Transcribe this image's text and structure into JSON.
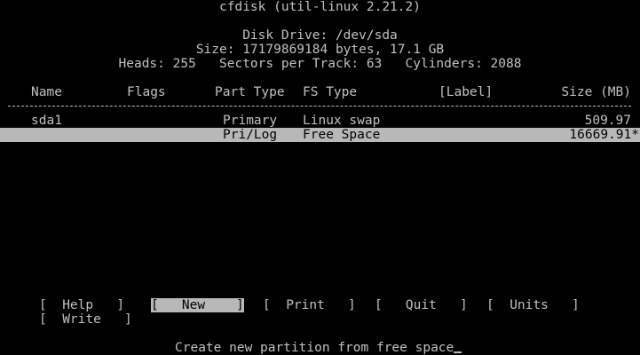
{
  "header": {
    "program": "cfdisk (util-linux 2.21.2)",
    "drive": "Disk Drive: /dev/sda",
    "size": "Size: 17179869184 bytes, 17.1 GB",
    "geometry": "Heads: 255   Sectors per Track: 63   Cylinders: 2088"
  },
  "columns": {
    "name": "Name",
    "flags": "Flags",
    "part_type": "Part Type",
    "fs_type": "FS Type",
    "label": "[Label]",
    "size": "Size (MB)"
  },
  "partitions": [
    {
      "name": "sda1",
      "flags": "",
      "part_type": "Primary",
      "fs_type": "Linux swap",
      "label": "",
      "size": "509.97"
    },
    {
      "name": "",
      "flags": "",
      "part_type": "Pri/Log",
      "fs_type": "Free Space",
      "label": "",
      "size": "16669.91*"
    }
  ],
  "menu": {
    "help": "Help",
    "new": "New",
    "print": "Print",
    "quit": "Quit",
    "units": "Units",
    "write": "Write"
  },
  "status": "Create new partition from free space",
  "colors": {
    "background": "#000000",
    "foreground": "#c0c0c0",
    "highlight": "#b8b8b8"
  }
}
